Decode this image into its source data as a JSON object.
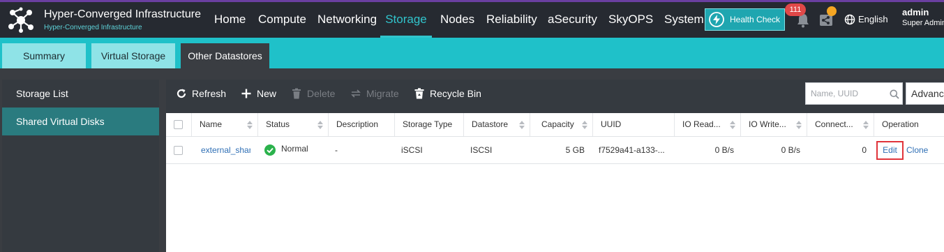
{
  "brand": {
    "title": "Hyper-Converged Infrastructure",
    "subtitle": "Hyper-Converged Infrastructure",
    "accent": "#31c4cc"
  },
  "nav": {
    "items": [
      {
        "label": "Home"
      },
      {
        "label": "Compute"
      },
      {
        "label": "Networking"
      },
      {
        "label": "Storage",
        "active": true
      },
      {
        "label": "Nodes"
      },
      {
        "label": "Reliability"
      },
      {
        "label": "aSecurity"
      },
      {
        "label": "SkyOPS"
      },
      {
        "label": "System"
      }
    ],
    "health_check": "Health Check",
    "notification_count": "111",
    "language": "English",
    "user": {
      "name": "admin",
      "role": "Super Admin"
    }
  },
  "subtabs": [
    {
      "label": "Summary"
    },
    {
      "label": "Virtual Storage"
    },
    {
      "label": "Other Datastores",
      "active": true
    }
  ],
  "sidebar": {
    "items": [
      {
        "label": "Storage List"
      },
      {
        "label": "Shared Virtual Disks",
        "active": true
      }
    ]
  },
  "toolbar": {
    "refresh": "Refresh",
    "new": "New",
    "delete": "Delete",
    "migrate": "Migrate",
    "recycle_bin": "Recycle Bin",
    "search_placeholder": "Name, UUID",
    "advanced": "Advanced"
  },
  "table": {
    "columns": [
      "Name",
      "Status",
      "Description",
      "Storage Type",
      "Datastore",
      "Capacity",
      "UUID",
      "IO Read...",
      "IO Write...",
      "Connect...",
      "Operation"
    ],
    "rows": [
      {
        "name": "external_shar",
        "status": "Normal",
        "description": "-",
        "storage_type": "iSCSI",
        "datastore": "ISCSI",
        "capacity": "5 GB",
        "uuid": "f7529a41-a133-...",
        "io_read": "0 B/s",
        "io_write": "0 B/s",
        "connections": "0",
        "op_edit": "Edit",
        "op_clone": "Clone"
      }
    ]
  },
  "icons": {
    "logo": "molecule-logo-icon",
    "health": "lightning-icon",
    "bell": "bell-icon",
    "share": "share-icon",
    "globe": "globe-icon",
    "refresh": "refresh-icon",
    "new": "plus-icon",
    "delete": "trash-icon",
    "migrate": "migrate-arrows-icon",
    "recycle_bin": "recycle-bin-icon",
    "search": "search-icon",
    "status_ok": "check-circle-icon"
  },
  "colors": {
    "topbar": "#262a31",
    "subbar": "#1fc1c9",
    "link": "#2f6fb5",
    "status_ok": "#2bb24c",
    "highlight": "#e0343b"
  }
}
